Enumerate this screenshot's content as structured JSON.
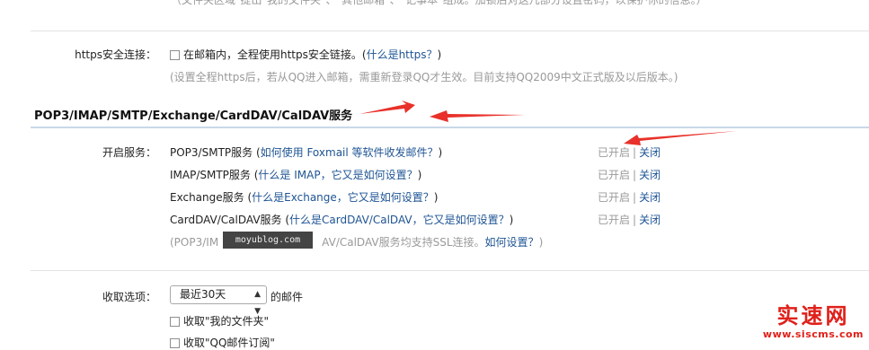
{
  "top_note": "（文件夹区域\"提出\"我的文件夹\"、\"其他邮箱\"、\"记事本\"组成。加锁后对这几部分设置密码，以保护你的信息。）",
  "https": {
    "label": "https安全连接：",
    "checkbox_text": "在邮箱内，全程使用https安全链接。",
    "link_prefix": "(",
    "link": "什么是https？",
    "link_suffix": ")",
    "note": "(设置全程https后，若从QQ进入邮箱，需重新登录QQ才生效。目前支持QQ2009中文正式版及以后版本。)"
  },
  "section_title": "POP3/IMAP/SMTP/Exchange/CardDAV/CalDAV服务",
  "services": {
    "label": "开启服务：",
    "rows": [
      {
        "name": "POP3/SMTP服务",
        "open": " (",
        "help": "如何使用 Foxmail 等软件收发邮件？",
        "close": ")",
        "status": "已开启",
        "action": "关闭"
      },
      {
        "name": "IMAP/SMTP服务",
        "open": " (",
        "help": "什么是 IMAP，它又是如何设置？",
        "close": ")",
        "status": "已开启",
        "action": "关闭"
      },
      {
        "name": "Exchange服务",
        "open": " (",
        "help": "什么是Exchange，它又是如何设置？",
        "close": ")",
        "status": "已开启",
        "action": "关闭"
      },
      {
        "name": "CardDAV/CalDAV服务",
        "open": " (",
        "help": "什么是CardDAV/CalDAV，它又是如何设置？",
        "close": ")",
        "status": "已开启",
        "action": "关闭"
      }
    ],
    "ssl_note_a": "(POP3/IM",
    "ssl_note_b": "AV/CalDAV服务均支持SSL连接。",
    "ssl_link": "如何设置？",
    "ssl_note_c": ")",
    "status_sep": "|"
  },
  "watermark": "moyublog.com",
  "receive": {
    "label": "收取选项：",
    "select_value": "最近30天",
    "select_suffix": "的邮件",
    "opt1": "收取\"我的文件夹\"",
    "opt2": "收取\"QQ邮件订阅\""
  },
  "brand": {
    "name": "实速网",
    "url": "www.siscms.com"
  },
  "colors": {
    "link": "#1e5494",
    "arrow": "#e8312a",
    "brand": "#e0201a"
  }
}
